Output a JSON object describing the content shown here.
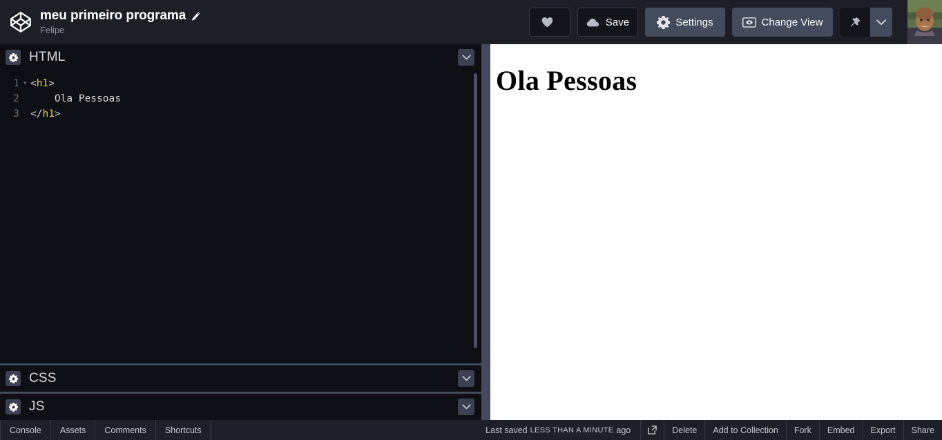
{
  "header": {
    "logo_icon": "codepen-logo-icon",
    "pen_title": "meu primeiro programa",
    "edit_icon": "pencil-icon",
    "author": "Felipe",
    "actions": {
      "love_label": "",
      "love_icon": "heart-icon",
      "save_label": "Save",
      "save_icon": "cloud-icon",
      "settings_label": "Settings",
      "settings_icon": "gear-icon",
      "change_view_label": "Change View",
      "change_view_icon": "eye-box-icon",
      "pin_icon": "pin-icon",
      "pin_caret_icon": "chevron-down-icon",
      "avatar_name": "user-avatar"
    }
  },
  "editors": {
    "panels": [
      {
        "label": "HTML",
        "gear_icon": "gear-icon",
        "caret_icon": "chevron-down-icon"
      },
      {
        "label": "CSS",
        "gear_icon": "gear-icon",
        "caret_icon": "chevron-down-icon"
      },
      {
        "label": "JS",
        "gear_icon": "gear-icon",
        "caret_icon": "chevron-down-icon"
      }
    ],
    "html_code": {
      "lines": [
        {
          "number": "1",
          "fold": "▾",
          "open_bracket": "<",
          "tag": "h1",
          "close_bracket": ">",
          "indent": "",
          "text": ""
        },
        {
          "number": "2",
          "fold": "",
          "open_bracket": "",
          "tag": "",
          "close_bracket": "",
          "indent": "    ",
          "text": "Ola Pessoas"
        },
        {
          "number": "3",
          "fold": "",
          "open_bracket": "</",
          "tag": "h1",
          "close_bracket": ">",
          "indent": "",
          "text": ""
        }
      ]
    }
  },
  "preview": {
    "heading": "Ola Pessoas"
  },
  "bottom": {
    "tabs": [
      {
        "label": "Console"
      },
      {
        "label": "Assets"
      },
      {
        "label": "Comments"
      },
      {
        "label": "Shortcuts"
      }
    ],
    "saved_prefix": "Last saved",
    "saved_relative": "LESS THAN A MINUTE",
    "saved_suffix": "ago",
    "open_external_icon": "open-external-icon",
    "right_items": [
      {
        "label": "Delete"
      },
      {
        "label": "Add to Collection"
      },
      {
        "label": "Fork"
      },
      {
        "label": "Embed"
      },
      {
        "label": "Export"
      },
      {
        "label": "Share"
      }
    ]
  },
  "colors": {
    "header_bg": "#1e1f26",
    "panel_header_bg": "#0e0f14",
    "editor_bg": "#0e0f14",
    "divider": "#454b5c",
    "slate_button": "#444b5c",
    "dark_button": "#14151b",
    "tag_yellow": "#e5d35b",
    "text_light": "#d7dae0",
    "muted": "#8c919e"
  }
}
